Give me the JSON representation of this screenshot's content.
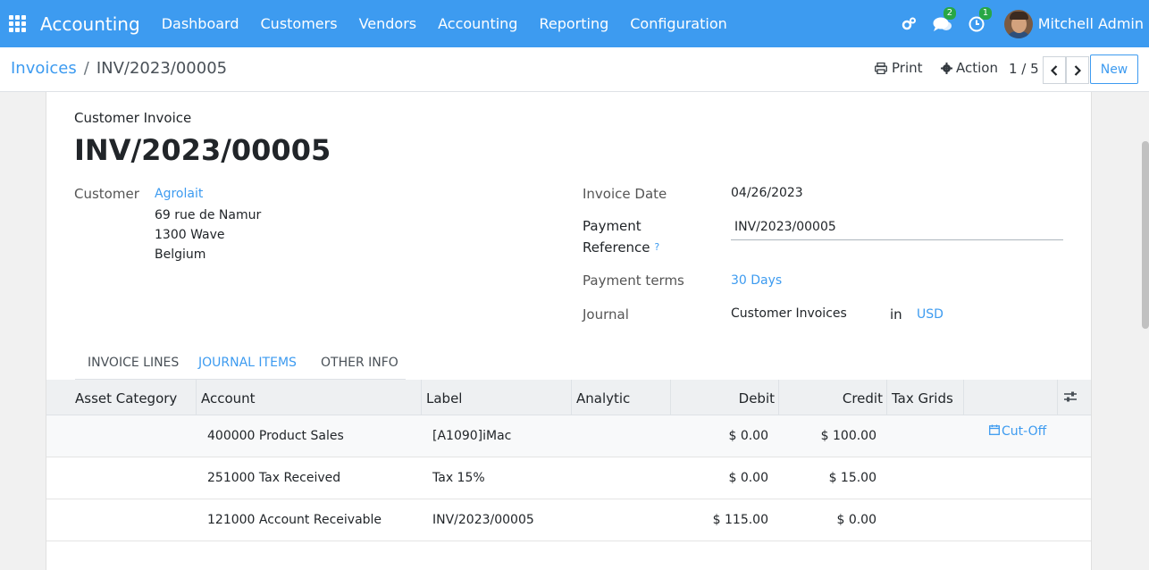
{
  "nav": {
    "brand": "Accounting",
    "menu": [
      "Dashboard",
      "Customers",
      "Vendors",
      "Accounting",
      "Reporting",
      "Configuration"
    ],
    "messages_count": "2",
    "activities_count": "1",
    "user": "Mitchell Admin"
  },
  "control": {
    "breadcrumb_root": "Invoices",
    "breadcrumb_sep": "/",
    "breadcrumb_current": "INV/2023/00005",
    "print_label": "Print",
    "action_label": "Action",
    "pager": "1 / 5",
    "new_label": "New"
  },
  "form": {
    "doc_type": "Customer Invoice",
    "doc_name": "INV/2023/00005",
    "customer_label": "Customer",
    "customer_name": "Agrolait",
    "address_line1": "69 rue de Namur",
    "address_line2": "1300 Wave",
    "address_line3": "Belgium",
    "invoice_date_label": "Invoice Date",
    "invoice_date": "04/26/2023",
    "payment_ref_label_1": "Payment",
    "payment_ref_label_2": "Reference",
    "payment_ref_help": "?",
    "payment_ref": "INV/2023/00005",
    "payment_terms_label": "Payment terms",
    "payment_terms": "30 Days",
    "journal_label": "Journal",
    "journal": "Customer Invoices",
    "in_label": "in",
    "currency": "USD"
  },
  "tabs": [
    "INVOICE LINES",
    "JOURNAL ITEMS",
    "OTHER INFO"
  ],
  "table": {
    "headers": [
      "Asset Category",
      "Account",
      "Label",
      "Analytic",
      "Debit",
      "Credit",
      "Tax Grids"
    ],
    "rows": [
      {
        "account": "400000 Product Sales",
        "label": "[A1090]iMac",
        "debit": "$ 0.00",
        "credit": "$ 100.00",
        "extra": "Cut-Off"
      },
      {
        "account": "251000 Tax Received",
        "label": "Tax 15%",
        "debit": "$ 0.00",
        "credit": "$ 15.00",
        "extra": ""
      },
      {
        "account": "121000 Account Receivable",
        "label": "INV/2023/00005",
        "debit": "$ 115.00",
        "credit": "$ 0.00",
        "extra": ""
      }
    ]
  },
  "colors": {
    "primary": "#3d9bf0",
    "badge": "#28a745"
  }
}
